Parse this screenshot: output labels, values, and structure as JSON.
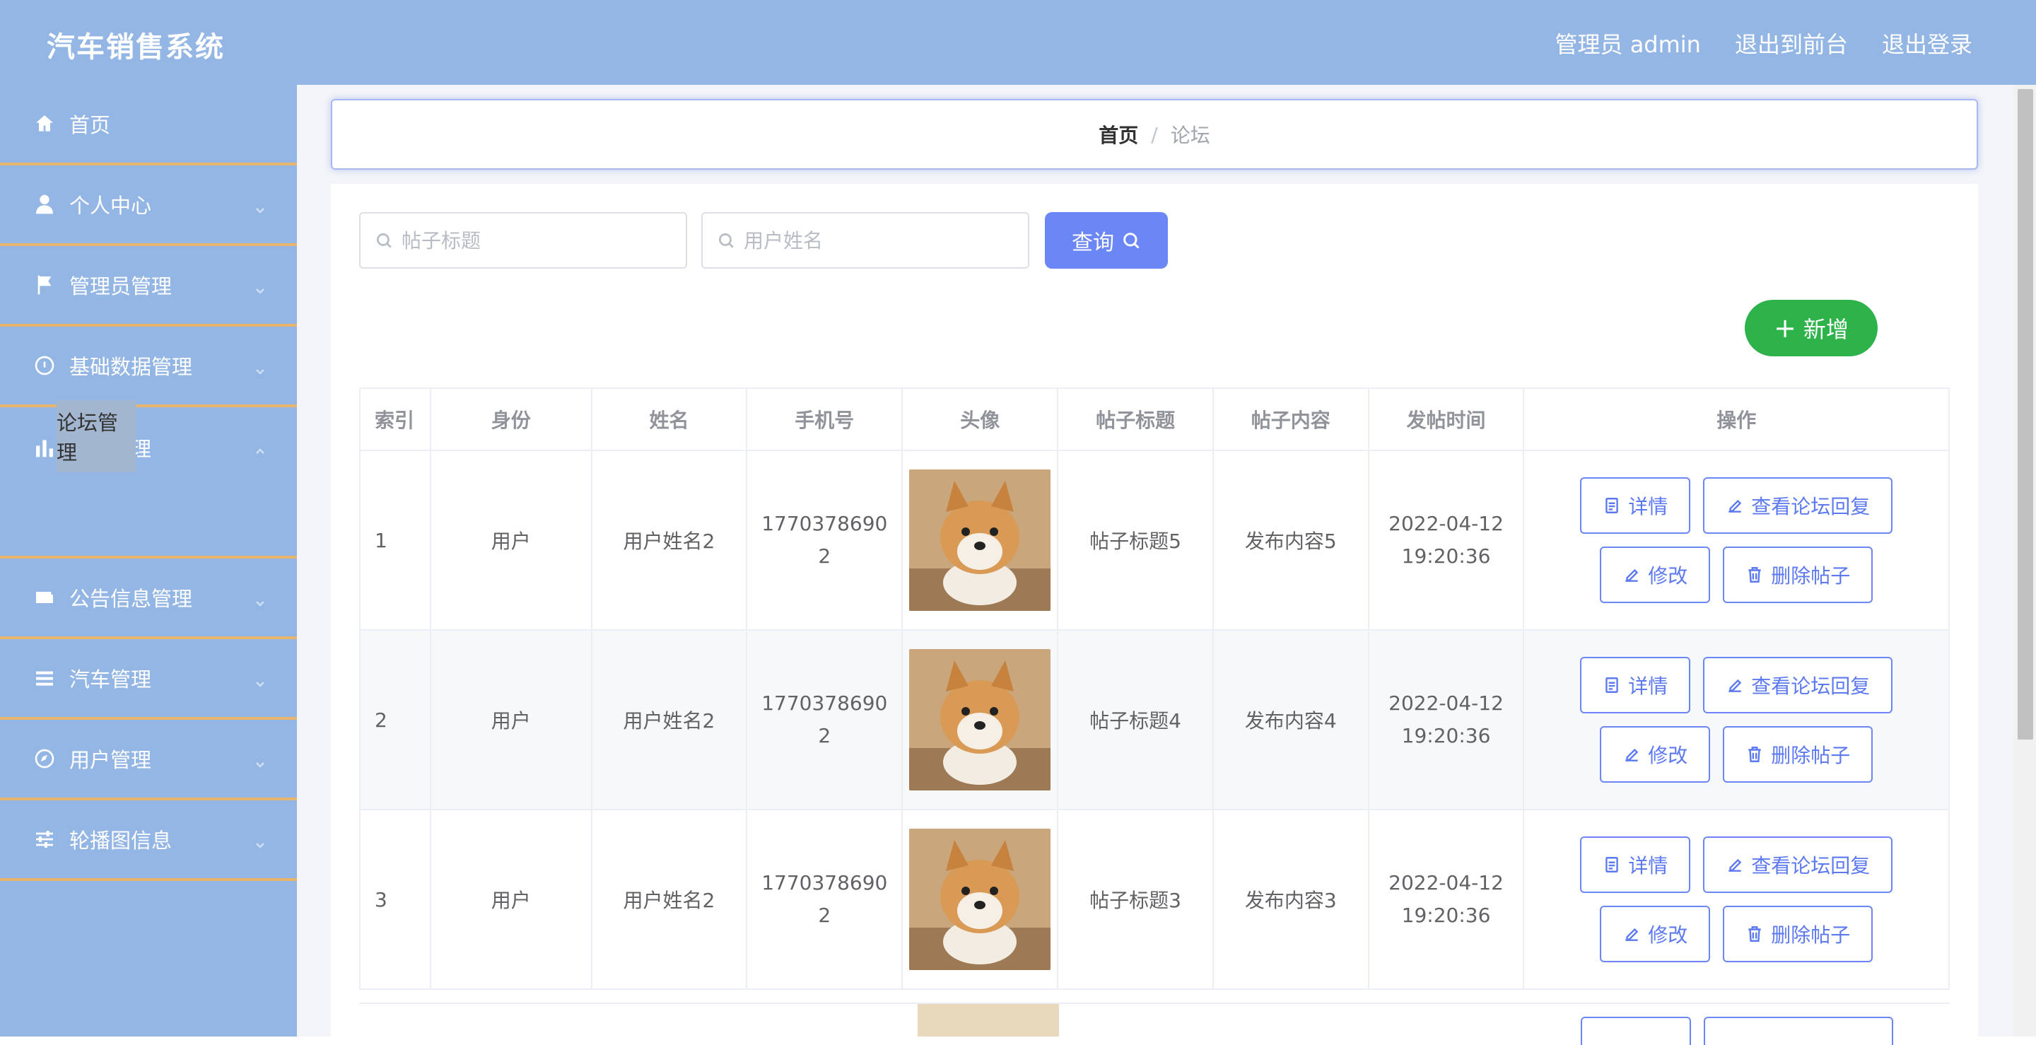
{
  "header": {
    "app_title": "汽车销售系统",
    "admin_label": "管理员 admin",
    "exit_front": "退出到前台",
    "logout": "退出登录"
  },
  "sidebar": {
    "items": [
      {
        "label": "首页",
        "icon": "home-icon"
      },
      {
        "label": "个人中心",
        "icon": "user-icon"
      },
      {
        "label": "管理员管理",
        "icon": "flag-icon"
      },
      {
        "label": "基础数据管理",
        "icon": "gauge-icon"
      },
      {
        "label": "论坛管理",
        "icon": "chart-bar-icon"
      },
      {
        "label": "公告信息管理",
        "icon": "wallet-icon"
      },
      {
        "label": "汽车管理",
        "icon": "list-icon"
      },
      {
        "label": "用户管理",
        "icon": "compass-icon"
      },
      {
        "label": "轮播图信息",
        "icon": "sliders-icon"
      }
    ],
    "sub_active": "论坛管理"
  },
  "breadcrumb": {
    "home": "首页",
    "separator": "/",
    "current": "论坛"
  },
  "search": {
    "title_placeholder": "帖子标题",
    "name_placeholder": "用户姓名",
    "query_label": "查询"
  },
  "add_label": "新增",
  "table": {
    "headers": [
      "索引",
      "身份",
      "姓名",
      "手机号",
      "头像",
      "帖子标题",
      "帖子内容",
      "发帖时间",
      "操作"
    ],
    "rows": [
      {
        "index": "1",
        "role": "用户",
        "name": "用户姓名2",
        "phone_a": "1770378690",
        "phone_b": "2",
        "title": "帖子标题5",
        "content": "发布内容5",
        "date": "2022-04-12",
        "time": "19:20:36"
      },
      {
        "index": "2",
        "role": "用户",
        "name": "用户姓名2",
        "phone_a": "1770378690",
        "phone_b": "2",
        "title": "帖子标题4",
        "content": "发布内容4",
        "date": "2022-04-12",
        "time": "19:20:36"
      },
      {
        "index": "3",
        "role": "用户",
        "name": "用户姓名2",
        "phone_a": "1770378690",
        "phone_b": "2",
        "title": "帖子标题3",
        "content": "发布内容3",
        "date": "2022-04-12",
        "time": "19:20:36"
      }
    ],
    "actions": {
      "detail": "详情",
      "view_reply": "查看论坛回复",
      "edit": "修改",
      "delete": "删除帖子"
    }
  },
  "colors": {
    "header_bg": "#94b6e4",
    "sidebar_bg": "#94b6e4",
    "menu_divider": "#e8b56c",
    "primary": "#6b86f5",
    "success": "#2db34a"
  }
}
